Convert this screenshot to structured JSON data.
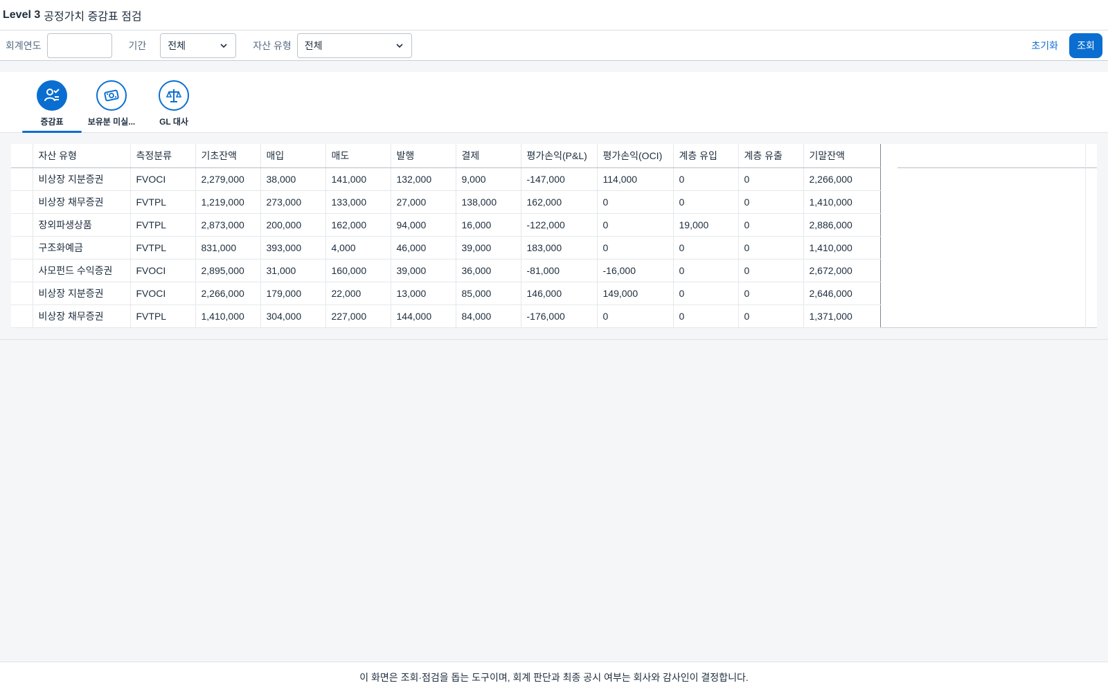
{
  "header": {
    "title_bold": "Level 3",
    "title_rest": "공정가치 증감표 점검"
  },
  "filters": {
    "year_label": "회계연도",
    "year_value": "",
    "period_label": "기간",
    "period_value": "전체",
    "asset_type_label": "자산 유형",
    "asset_type_value": "전체",
    "reset_label": "초기화",
    "search_label": "조회"
  },
  "tabs": [
    {
      "label": "증감표",
      "icon": "person-check-icon",
      "active": true
    },
    {
      "label": "보유분 미실...",
      "icon": "money-card-icon",
      "active": false
    },
    {
      "label": "GL 대사",
      "icon": "scale-icon",
      "active": false
    }
  ],
  "table": {
    "columns": [
      "자산 유형",
      "측정분류",
      "기초잔액",
      "매입",
      "매도",
      "발행",
      "결제",
      "평가손익(P&L)",
      "평가손익(OCI)",
      "계층 유입",
      "계층 유출",
      "기말잔액"
    ],
    "rows": [
      [
        "비상장 지분증권",
        "FVOCI",
        "2,279,000",
        "38,000",
        "141,000",
        "132,000",
        "9,000",
        "-147,000",
        "114,000",
        "0",
        "0",
        "2,266,000"
      ],
      [
        "비상장 채무증권",
        "FVTPL",
        "1,219,000",
        "273,000",
        "133,000",
        "27,000",
        "138,000",
        "162,000",
        "0",
        "0",
        "0",
        "1,410,000"
      ],
      [
        "장외파생상품",
        "FVTPL",
        "2,873,000",
        "200,000",
        "162,000",
        "94,000",
        "16,000",
        "-122,000",
        "0",
        "19,000",
        "0",
        "2,886,000"
      ],
      [
        "구조화예금",
        "FVTPL",
        "831,000",
        "393,000",
        "4,000",
        "46,000",
        "39,000",
        "183,000",
        "0",
        "0",
        "0",
        "1,410,000"
      ],
      [
        "사모펀드 수익증권",
        "FVOCI",
        "2,895,000",
        "31,000",
        "160,000",
        "39,000",
        "36,000",
        "-81,000",
        "-16,000",
        "0",
        "0",
        "2,672,000"
      ],
      [
        "비상장 지분증권",
        "FVOCI",
        "2,266,000",
        "179,000",
        "22,000",
        "13,000",
        "85,000",
        "146,000",
        "149,000",
        "0",
        "0",
        "2,646,000"
      ],
      [
        "비상장 채무증권",
        "FVTPL",
        "1,410,000",
        "304,000",
        "227,000",
        "144,000",
        "84,000",
        "-176,000",
        "0",
        "0",
        "0",
        "1,371,000"
      ]
    ]
  },
  "footer": {
    "note": "이 화면은 조회·점검을 돕는 도구이며, 회계 판단과 최종 공시 여부는 회사와 감사인이 결정합니다."
  },
  "colors": {
    "accent": "#0a6ed1",
    "background": "#f5f6f7"
  }
}
